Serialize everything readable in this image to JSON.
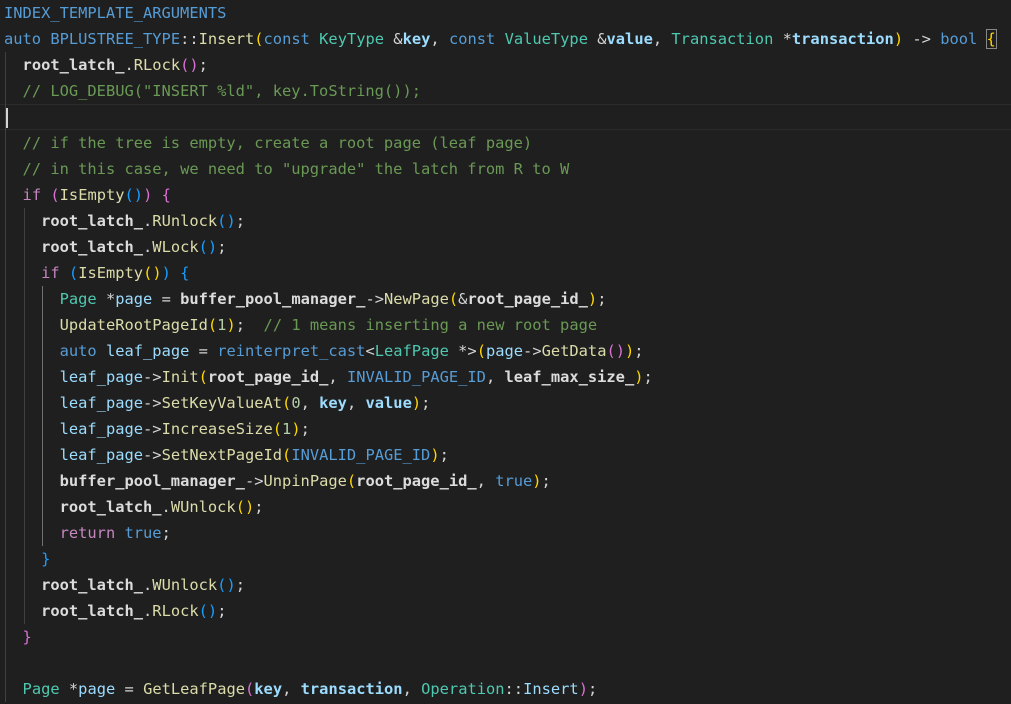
{
  "editor": {
    "lines": [
      {
        "indent": 0,
        "tokens": [
          [
            "INDEX_TEMPLATE_ARGUMENTS",
            "c-macro"
          ]
        ]
      },
      {
        "indent": 0,
        "tokens": [
          [
            "auto",
            "c-kw"
          ],
          [
            " ",
            ""
          ],
          [
            "BPLUSTREE_TYPE",
            "c-macro"
          ],
          [
            "::",
            "c-op"
          ],
          [
            "Insert",
            "c-fn"
          ],
          [
            "(",
            "b1"
          ],
          [
            "const",
            "c-kw"
          ],
          [
            " ",
            ""
          ],
          [
            "KeyType",
            "c-type"
          ],
          [
            " &",
            "c-op"
          ],
          [
            "key",
            "c-param"
          ],
          [
            ", ",
            "c-op"
          ],
          [
            "const",
            "c-kw"
          ],
          [
            " ",
            ""
          ],
          [
            "ValueType",
            "c-type"
          ],
          [
            " &",
            "c-op"
          ],
          [
            "value",
            "c-param"
          ],
          [
            ", ",
            "c-op"
          ],
          [
            "Transaction",
            "c-type"
          ],
          [
            " *",
            "c-op"
          ],
          [
            "transaction",
            "c-param"
          ],
          [
            ")",
            "b1"
          ],
          [
            " -> ",
            "c-op"
          ],
          [
            "bool",
            "c-kw"
          ],
          [
            " ",
            ""
          ],
          [
            "{",
            "b1 brace-match"
          ]
        ]
      },
      {
        "indent": 2,
        "tokens": [
          [
            "root_latch_",
            "c-mem"
          ],
          [
            ".",
            "c-op"
          ],
          [
            "RLock",
            "c-fn"
          ],
          [
            "()",
            "b2"
          ],
          [
            ";",
            "c-op"
          ]
        ]
      },
      {
        "indent": 2,
        "tokens": [
          [
            "// LOG_DEBUG(\"INSERT %ld\", key.ToString());",
            "c-cmt"
          ]
        ]
      },
      {
        "indent": 0,
        "tokens": [],
        "current": true
      },
      {
        "indent": 2,
        "tokens": [
          [
            "// if the tree is empty, create a root page (leaf page)",
            "c-cmt"
          ]
        ]
      },
      {
        "indent": 2,
        "tokens": [
          [
            "// in this case, we need to \"upgrade\" the latch from R to W",
            "c-cmt"
          ]
        ]
      },
      {
        "indent": 2,
        "tokens": [
          [
            "if",
            "c-ctrl"
          ],
          [
            " ",
            ""
          ],
          [
            "(",
            "b2"
          ],
          [
            "IsEmpty",
            "c-fn"
          ],
          [
            "()",
            "b3"
          ],
          [
            ")",
            "b2"
          ],
          [
            " ",
            ""
          ],
          [
            "{",
            "b2"
          ]
        ]
      },
      {
        "indent": 4,
        "tokens": [
          [
            "root_latch_",
            "c-mem"
          ],
          [
            ".",
            "c-op"
          ],
          [
            "RUnlock",
            "c-fn"
          ],
          [
            "()",
            "b3"
          ],
          [
            ";",
            "c-op"
          ]
        ]
      },
      {
        "indent": 4,
        "tokens": [
          [
            "root_latch_",
            "c-mem"
          ],
          [
            ".",
            "c-op"
          ],
          [
            "WLock",
            "c-fn"
          ],
          [
            "()",
            "b3"
          ],
          [
            ";",
            "c-op"
          ]
        ]
      },
      {
        "indent": 4,
        "tokens": [
          [
            "if",
            "c-ctrl"
          ],
          [
            " ",
            ""
          ],
          [
            "(",
            "b3"
          ],
          [
            "IsEmpty",
            "c-fn"
          ],
          [
            "()",
            "b1"
          ],
          [
            ")",
            "b3"
          ],
          [
            " ",
            ""
          ],
          [
            "{",
            "b3"
          ]
        ]
      },
      {
        "indent": 6,
        "tokens": [
          [
            "Page",
            "c-type"
          ],
          [
            " *",
            "c-op"
          ],
          [
            "page",
            "c-var"
          ],
          [
            " = ",
            "c-op"
          ],
          [
            "buffer_pool_manager_",
            "c-mem"
          ],
          [
            "->",
            "c-op"
          ],
          [
            "NewPage",
            "c-fn"
          ],
          [
            "(",
            "b1"
          ],
          [
            "&",
            "c-op"
          ],
          [
            "root_page_id_",
            "c-mem"
          ],
          [
            ")",
            "b1"
          ],
          [
            ";",
            "c-op"
          ]
        ]
      },
      {
        "indent": 6,
        "tokens": [
          [
            "UpdateRootPageId",
            "c-fn"
          ],
          [
            "(",
            "b1"
          ],
          [
            "1",
            "c-num"
          ],
          [
            ")",
            "b1"
          ],
          [
            ";",
            "c-op"
          ],
          [
            "  ",
            ""
          ],
          [
            "// 1 means inserting a new root page",
            "c-cmt"
          ]
        ]
      },
      {
        "indent": 6,
        "tokens": [
          [
            "auto",
            "c-kw"
          ],
          [
            " ",
            ""
          ],
          [
            "leaf_page",
            "c-var"
          ],
          [
            " = ",
            "c-op"
          ],
          [
            "reinterpret_cast",
            "c-kw"
          ],
          [
            "<",
            "c-op"
          ],
          [
            "LeafPage",
            "c-type"
          ],
          [
            " *>",
            "c-op"
          ],
          [
            "(",
            "b1"
          ],
          [
            "page",
            "c-var"
          ],
          [
            "->",
            "c-op"
          ],
          [
            "GetData",
            "c-fn"
          ],
          [
            "()",
            "b2"
          ],
          [
            ")",
            "b1"
          ],
          [
            ";",
            "c-op"
          ]
        ]
      },
      {
        "indent": 6,
        "tokens": [
          [
            "leaf_page",
            "c-var"
          ],
          [
            "->",
            "c-op"
          ],
          [
            "Init",
            "c-fn"
          ],
          [
            "(",
            "b1"
          ],
          [
            "root_page_id_",
            "c-mem"
          ],
          [
            ", ",
            "c-op"
          ],
          [
            "INVALID_PAGE_ID",
            "c-macro"
          ],
          [
            ", ",
            "c-op"
          ],
          [
            "leaf_max_size_",
            "c-mem"
          ],
          [
            ")",
            "b1"
          ],
          [
            ";",
            "c-op"
          ]
        ]
      },
      {
        "indent": 6,
        "tokens": [
          [
            "leaf_page",
            "c-var"
          ],
          [
            "->",
            "c-op"
          ],
          [
            "SetKeyValueAt",
            "c-fn"
          ],
          [
            "(",
            "b1"
          ],
          [
            "0",
            "c-num"
          ],
          [
            ", ",
            "c-op"
          ],
          [
            "key",
            "c-param"
          ],
          [
            ", ",
            "c-op"
          ],
          [
            "value",
            "c-param"
          ],
          [
            ")",
            "b1"
          ],
          [
            ";",
            "c-op"
          ]
        ]
      },
      {
        "indent": 6,
        "tokens": [
          [
            "leaf_page",
            "c-var"
          ],
          [
            "->",
            "c-op"
          ],
          [
            "IncreaseSize",
            "c-fn"
          ],
          [
            "(",
            "b1"
          ],
          [
            "1",
            "c-num"
          ],
          [
            ")",
            "b1"
          ],
          [
            ";",
            "c-op"
          ]
        ]
      },
      {
        "indent": 6,
        "tokens": [
          [
            "leaf_page",
            "c-var"
          ],
          [
            "->",
            "c-op"
          ],
          [
            "SetNextPageId",
            "c-fn"
          ],
          [
            "(",
            "b1"
          ],
          [
            "INVALID_PAGE_ID",
            "c-macro"
          ],
          [
            ")",
            "b1"
          ],
          [
            ";",
            "c-op"
          ]
        ]
      },
      {
        "indent": 6,
        "tokens": [
          [
            "buffer_pool_manager_",
            "c-mem"
          ],
          [
            "->",
            "c-op"
          ],
          [
            "UnpinPage",
            "c-fn"
          ],
          [
            "(",
            "b1"
          ],
          [
            "root_page_id_",
            "c-mem"
          ],
          [
            ", ",
            "c-op"
          ],
          [
            "true",
            "c-kw"
          ],
          [
            ")",
            "b1"
          ],
          [
            ";",
            "c-op"
          ]
        ]
      },
      {
        "indent": 6,
        "tokens": [
          [
            "root_latch_",
            "c-mem"
          ],
          [
            ".",
            "c-op"
          ],
          [
            "WUnlock",
            "c-fn"
          ],
          [
            "()",
            "b1"
          ],
          [
            ";",
            "c-op"
          ]
        ]
      },
      {
        "indent": 6,
        "tokens": [
          [
            "return",
            "c-ctrl"
          ],
          [
            " ",
            ""
          ],
          [
            "true",
            "c-kw"
          ],
          [
            ";",
            "c-op"
          ]
        ]
      },
      {
        "indent": 4,
        "tokens": [
          [
            "}",
            "b3"
          ]
        ]
      },
      {
        "indent": 4,
        "tokens": [
          [
            "root_latch_",
            "c-mem"
          ],
          [
            ".",
            "c-op"
          ],
          [
            "WUnlock",
            "c-fn"
          ],
          [
            "()",
            "b3"
          ],
          [
            ";",
            "c-op"
          ]
        ]
      },
      {
        "indent": 4,
        "tokens": [
          [
            "root_latch_",
            "c-mem"
          ],
          [
            ".",
            "c-op"
          ],
          [
            "RLock",
            "c-fn"
          ],
          [
            "()",
            "b3"
          ],
          [
            ";",
            "c-op"
          ]
        ]
      },
      {
        "indent": 2,
        "tokens": [
          [
            "}",
            "b2"
          ]
        ]
      },
      {
        "indent": 0,
        "tokens": []
      },
      {
        "indent": 2,
        "tokens": [
          [
            "Page",
            "c-type"
          ],
          [
            " *",
            "c-op"
          ],
          [
            "page",
            "c-var"
          ],
          [
            " = ",
            "c-op"
          ],
          [
            "GetLeafPage",
            "c-fn"
          ],
          [
            "(",
            "b2"
          ],
          [
            "key",
            "c-param"
          ],
          [
            ", ",
            "c-op"
          ],
          [
            "transaction",
            "c-param"
          ],
          [
            ", ",
            "c-op"
          ],
          [
            "Operation",
            "c-type"
          ],
          [
            "::",
            "c-op"
          ],
          [
            "Insert",
            "c-var"
          ],
          [
            ")",
            "b2"
          ],
          [
            ";",
            "c-op"
          ]
        ]
      }
    ]
  }
}
